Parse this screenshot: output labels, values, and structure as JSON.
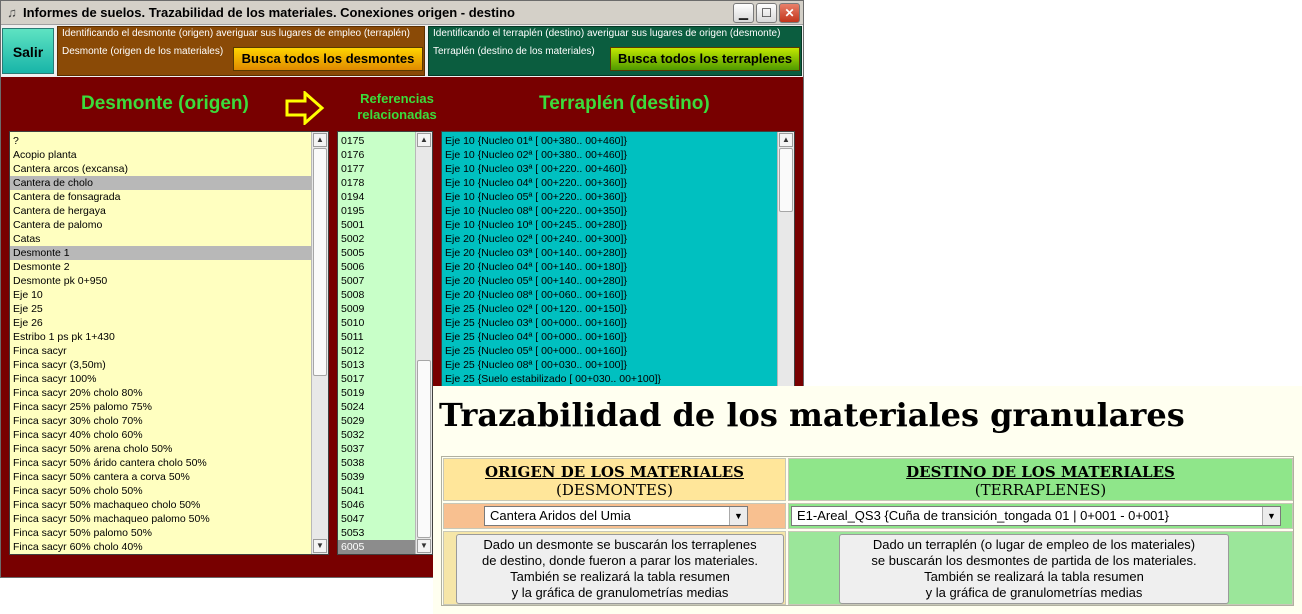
{
  "window": {
    "title": "Informes de suelos. Trazabilidad de los materiales. Conexiones origen - destino",
    "min_icon": "minimize-icon",
    "max_icon": "maximize-icon",
    "close_icon": "close-icon"
  },
  "toolbar": {
    "salir_label": "Salir",
    "group_origen": {
      "caption": "Identificando el desmonte (origen) averiguar sus lugares de empleo  (terraplén)",
      "sublabel": "Desmonte (origen de los materiales)",
      "button_label": "Busca todos los desmontes"
    },
    "group_destino": {
      "caption": "Identificando el terraplén (destino) averiguar sus lugares de origen (desmonte)",
      "sublabel": "Terraplén (destino de los materiales)",
      "button_label": "Busca todos los terraplenes"
    }
  },
  "headers": {
    "origen": "Desmonte (origen)",
    "referencias_line1": "Referencias",
    "referencias_line2": "relacionadas",
    "destino": "Terraplén (destino)"
  },
  "lists": {
    "desmontes": [
      "?",
      "Acopio planta",
      "Cantera arcos (excansa)",
      "Cantera de cholo",
      "Cantera de fonsagrada",
      "Cantera de hergaya",
      "Cantera de palomo",
      "Catas",
      "Desmonte 1",
      "Desmonte 2",
      "Desmonte pk 0+950",
      "Eje 10",
      "Eje 25",
      "Eje 26",
      "Estribo 1 ps pk 1+430",
      "Finca sacyr",
      "Finca sacyr (3,50m)",
      "Finca sacyr 100%",
      "Finca sacyr 20% cholo 80%",
      "Finca sacyr 25% palomo 75%",
      "Finca sacyr 30% cholo 70%",
      "Finca sacyr 40% cholo 60%",
      "Finca sacyr 50% arena cholo 50%",
      "Finca sacyr 50% árido cantera cholo 50%",
      "Finca sacyr 50% cantera a corva 50%",
      "Finca sacyr 50% cholo 50%",
      "Finca sacyr 50% machaqueo cholo 50%",
      "Finca sacyr 50% machaqueo palomo 50%",
      "Finca sacyr 50% palomo 50%",
      "Finca sacyr 60% cholo 40%"
    ],
    "referencias": [
      "0175",
      "0176",
      "0177",
      "0178",
      "0194",
      "0195",
      "5001",
      "5002",
      "5005",
      "5006",
      "5007",
      "5008",
      "5009",
      "5010",
      "5011",
      "5012",
      "5013",
      "5017",
      "5019",
      "5024",
      "5029",
      "5032",
      "5037",
      "5038",
      "5039",
      "5041",
      "5046",
      "5047",
      "5053",
      "6005"
    ],
    "terraplenes": [
      "Eje 10 {Nucleo 01ª [ 00+380.. 00+460]}",
      "Eje 10 {Nucleo 02ª [ 00+380.. 00+460]}",
      "Eje 10 {Nucleo 03ª [ 00+220.. 00+460]}",
      "Eje 10 {Nucleo 04ª [ 00+220.. 00+360]}",
      "Eje 10 {Nucleo 05ª [ 00+220.. 00+360]}",
      "Eje 10 {Nucleo 08ª [ 00+220.. 00+350]}",
      "Eje 10 {Nucleo 10ª [ 00+245.. 00+280]}",
      "Eje 20 {Nucleo 02ª [ 00+240.. 00+300]}",
      "Eje 20 {Nucleo 03ª [ 00+140.. 00+280]}",
      "Eje 20 {Nucleo 04ª [ 00+140.. 00+180]}",
      "Eje 20 {Nucleo 05ª [ 00+140.. 00+280]}",
      "Eje 20 {Nucleo 08ª [ 00+060.. 00+160]}",
      "Eje 25 {Nucleo 02ª [ 00+120.. 00+150]}",
      "Eje 25 {Nucleo 03ª [ 00+000.. 00+160]}",
      "Eje 25 {Nucleo 04ª [ 00+000.. 00+160]}",
      "Eje 25 {Nucleo 05ª [ 00+000.. 00+160]}",
      "Eje 25 {Nucleo 08ª [ 00+030.. 00+100]}",
      "Eje 25 {Suelo estabilizado [ 00+030.. 00+100]}"
    ]
  },
  "web": {
    "title": "Trazabilidad de los materiales granulares",
    "origen_header": "ORIGEN DE LOS MATERIALES",
    "origen_subheader": "(DESMONTES)",
    "destino_header": "DESTINO DE LOS MATERIALES",
    "destino_subheader": "(TERRAPLENES)",
    "origen_select_value": "Cantera Aridos del Umia",
    "destino_select_value": "E1-Areal_QS3 {Cuña de transición_tongada 01 | 0+001 - 0+001}",
    "origen_button_lines": [
      "Dado un desmonte se buscarán los terraplenes",
      "de destino, donde fueron a parar  los materiales.",
      "También se realizará la tabla resumen",
      "y la gráfica de granulometrías medias"
    ],
    "destino_button_lines": [
      "Dado un terraplén (o lugar de empleo de los materiales)",
      "se buscarán los desmontes de partida de los materiales.",
      "También se realizará la tabla resumen",
      "y la gráfica de granulometrías medias"
    ]
  },
  "colors": {
    "window_bg": "#780000",
    "header_green": "#3bdc3b",
    "list_yellow": "#ffffc0",
    "list_green": "#c8ffc8",
    "list_teal": "#00c0c0",
    "web_bg": "#fffff0",
    "origen_header_bg": "#ffe69a",
    "destino_header_bg": "#8fe68a",
    "origen_select_bg": "#f8c090",
    "destino_select_bg": "#8fe68a",
    "origen_button_bg": "#f6e6a8",
    "destino_button_bg": "#9be69a"
  }
}
